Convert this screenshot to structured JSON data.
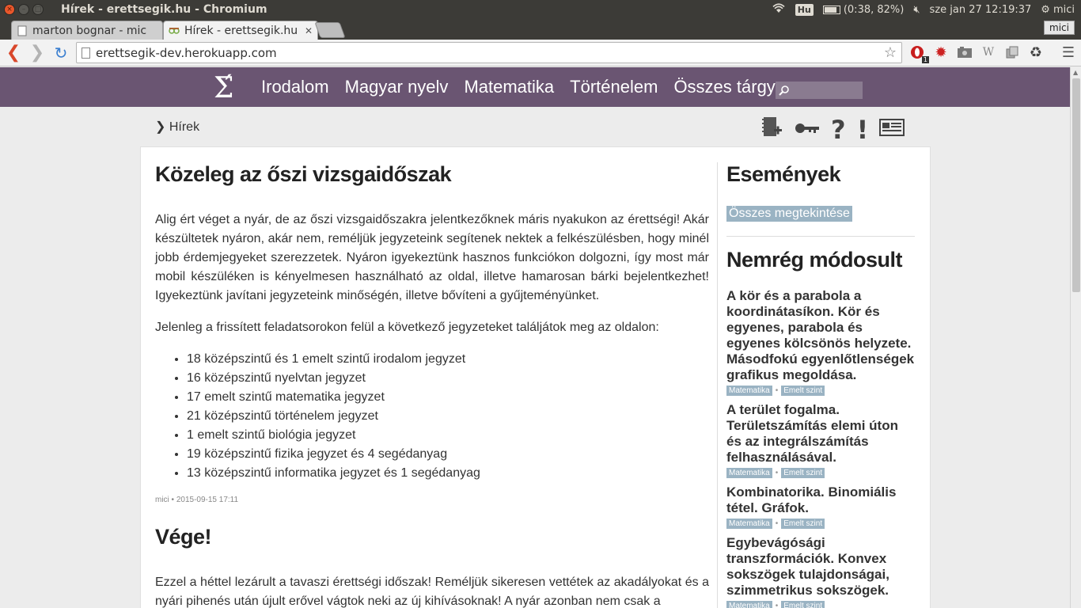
{
  "window": {
    "title": "Hírek - erettsegik.hu - Chromium",
    "tray": {
      "kbd": "Hu",
      "battery_text": "(0:38, 82%)",
      "battery_level": 0.82,
      "clock": "sze jan 27 12:19:37",
      "user": "mici"
    }
  },
  "tabs": [
    {
      "label": "marton bognar - mic",
      "active": false
    },
    {
      "label": "Hírek - erettsegik.hu",
      "active": true
    }
  ],
  "profile_label": "mici",
  "address": "erettsegik-dev.herokuapp.com",
  "ext_badge": "1",
  "site": {
    "logo": "Σ́",
    "nav": [
      "Irodalom",
      "Magyar nyelv",
      "Matematika",
      "Történelem",
      "Összes tárgy"
    ],
    "search_placeholder": ""
  },
  "breadcrumb": "❯ Hírek",
  "articles": [
    {
      "title": "Közeleg az őszi vizsgaidőszak",
      "paragraphs": [
        "Alig ért véget a nyár, de az őszi vizsgaidőszakra jelentkezőknek máris nyakukon az érettségi! Akár készültetek nyáron, akár nem, reméljük jegyzeteink segítenek nektek a felkészülésben, hogy minél jobb érdemjegyeket szerezzetek. Nyáron igyekeztünk hasznos funkciókon dolgozni, így most már mobil készüléken is kényelmesen használható az oldal, illetve hamarosan bárki bejelentkezhet! Igyekeztünk javítani jegyzeteink minőségén, illetve bővíteni a gyűjteményünket.",
        "Jelenleg a frissített feladatsorokon felül a következő jegyzeteket találjátok meg az oldalon:"
      ],
      "list": [
        "18 középszintű és 1 emelt szintű irodalom jegyzet",
        "16 középszintű nyelvtan jegyzet",
        "17 emelt szintű matematika jegyzet",
        "21 középszintű történelem jegyzet",
        "1 emelt szintű biológia jegyzet",
        "19 középszintű fizika jegyzet és 4 segédanyag",
        "13 középszintű informatika jegyzet és 1 segédanyag"
      ],
      "meta": "mici • 2015-09-15 17:11"
    },
    {
      "title": "Vége!",
      "paragraphs": [
        "Ezzel a héttel lezárult a tavaszi érettségi időszak! Reméljük sikeresen vettétek az akadályokat és a nyári pihenés után újult erővel vágtok neki az új kihívásoknak! A nyár azonban nem csak a"
      ]
    }
  ],
  "sidebar": {
    "events_title": "Események",
    "view_all": "Összes megtekintése",
    "recent_title": "Nemrég módosult",
    "recent": [
      {
        "title": "A kör és a parabola a koordinátasíkon. Kör és egyenes, parabola és egyenes kölcsönös helyzete. Másodfokú egyenlőtlenségek grafikus megoldása.",
        "tags": [
          "Matematika",
          "Emelt szint"
        ]
      },
      {
        "title": "A terület fogalma. Területszámítás elemi úton és az integrálszámítás felhasználásával.",
        "tags": [
          "Matematika",
          "Emelt szint"
        ]
      },
      {
        "title": "Kombinatorika. Binomiális tétel. Gráfok.",
        "tags": [
          "Matematika",
          "Emelt szint"
        ]
      },
      {
        "title": "Egybevágósági transzformációk. Konvex sokszögek tulajdonságai, szimmetrikus sokszögek.",
        "tags": [
          "Matematika",
          "Emelt szint"
        ]
      }
    ]
  },
  "icons": {
    "nav_back": "back-arrow-icon",
    "nav_forward": "forward-arrow-icon",
    "reload": "reload-icon",
    "star": "bookmark-star-icon",
    "menu": "hamburger-menu-icon"
  },
  "colors": {
    "site_nav": "#6a5572",
    "tag": "#9ab3c3"
  }
}
